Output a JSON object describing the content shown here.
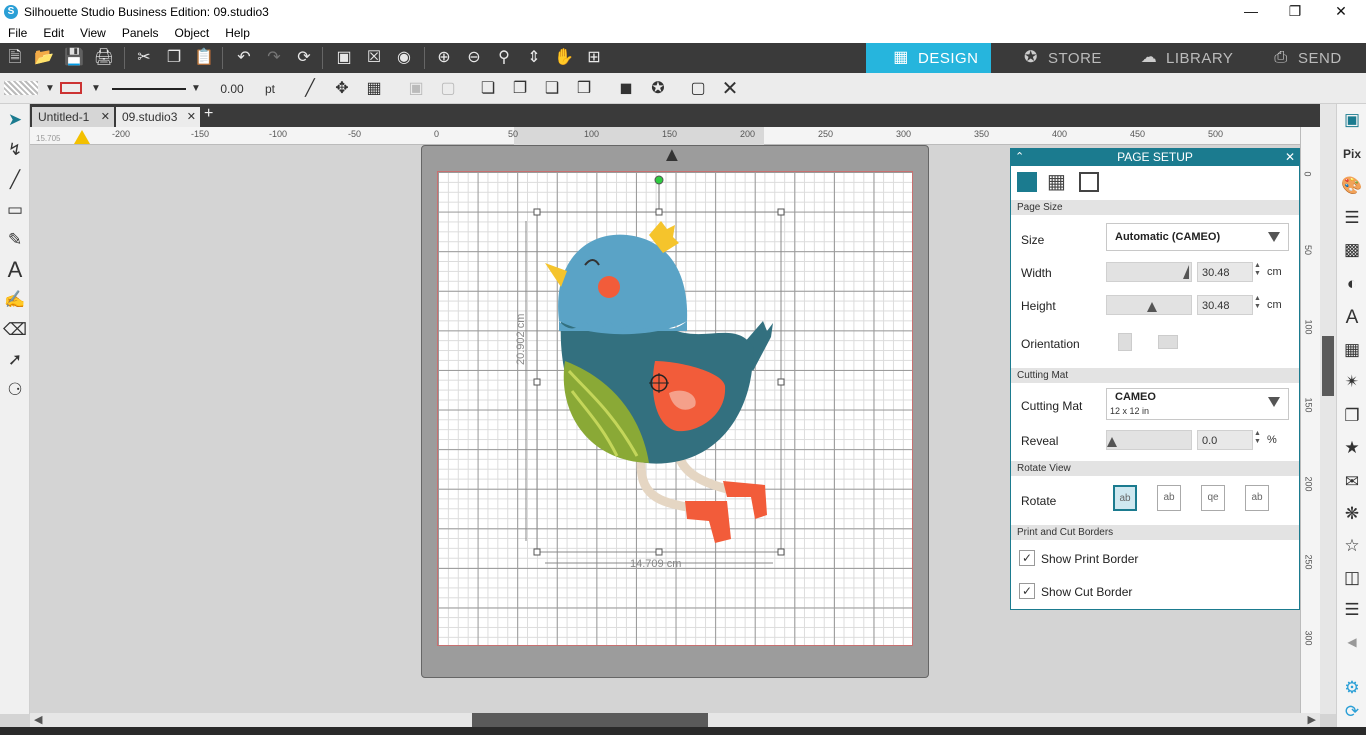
{
  "window": {
    "title": "Silhouette Studio Business Edition: 09.studio3",
    "app_icon": "S"
  },
  "menu": [
    "File",
    "Edit",
    "View",
    "Panels",
    "Object",
    "Help"
  ],
  "nav_tabs": [
    {
      "label": "DESIGN",
      "icon": "grid-icon",
      "active": true
    },
    {
      "label": "STORE",
      "icon": "store-icon",
      "active": false
    },
    {
      "label": "LIBRARY",
      "icon": "cloud-icon",
      "active": false
    },
    {
      "label": "SEND",
      "icon": "send-icon",
      "active": false
    }
  ],
  "line_toolbar": {
    "line_width": "0.00",
    "line_unit": "pt"
  },
  "doc_tabs": [
    {
      "label": "Untitled-1",
      "active": false
    },
    {
      "label": "09.studio3",
      "active": true
    }
  ],
  "ruler": {
    "h_ticks": [
      "-200",
      "-150",
      "-100",
      "-50",
      "0",
      "50",
      "100",
      "150",
      "200",
      "250",
      "300",
      "350",
      "400",
      "450",
      "500"
    ],
    "v_ticks": [
      "0",
      "50",
      "100",
      "150",
      "200",
      "250",
      "300"
    ],
    "coord_readout": "15.705"
  },
  "selection": {
    "height_label": "20.902 cm",
    "width_label": "14.709 cm"
  },
  "page_setup": {
    "title": "PAGE SETUP",
    "sections": {
      "page_size": "Page Size",
      "cutting_mat": "Cutting Mat",
      "rotate_view": "Rotate View",
      "print_cut_borders": "Print and Cut Borders"
    },
    "size_label": "Size",
    "size_value": "Automatic (CAMEO)",
    "width_label": "Width",
    "width_value": "30.48",
    "height_label": "Height",
    "height_value": "30.48",
    "unit": "cm",
    "orientation_label": "Orientation",
    "cutting_mat_label": "Cutting Mat",
    "cutting_mat_value": "CAMEO",
    "cutting_mat_sub": "12 x 12 in",
    "reveal_label": "Reveal",
    "reveal_value": "0.0",
    "reveal_unit": "%",
    "rotate_label": "Rotate",
    "rotate_options": [
      "ab",
      "ab",
      "qe",
      "ab"
    ],
    "show_print_border": "Show Print Border",
    "show_cut_border": "Show Cut Border"
  },
  "colors": {
    "accent": "#26b5dd",
    "panel_header": "#1b7b8f",
    "toolbar_dark": "#3a3a3a",
    "bird_blue": "#5aa3c6",
    "bird_dark_teal": "#33707f",
    "bird_green": "#8aa936",
    "bird_red": "#f25c3a"
  }
}
